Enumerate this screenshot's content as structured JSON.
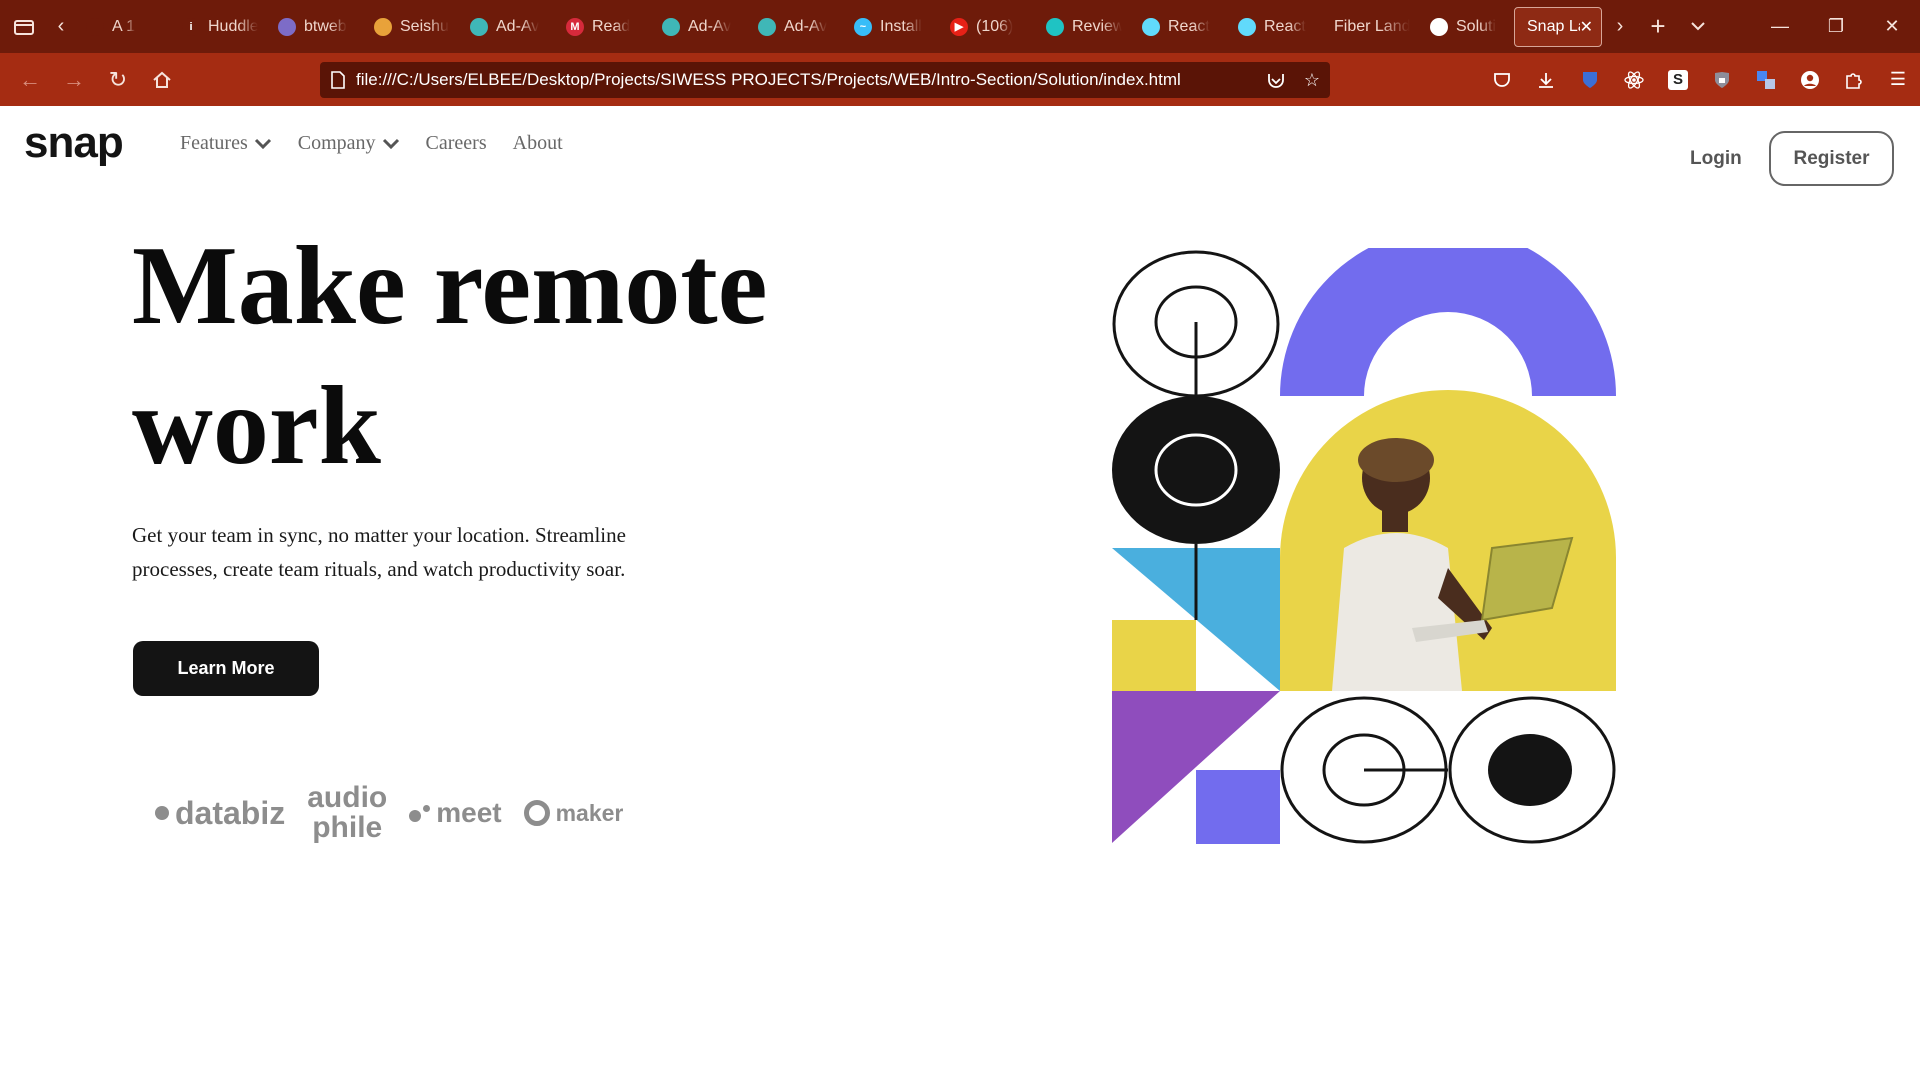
{
  "browser": {
    "tabs": [
      {
        "label": "A 1",
        "fav_color": "#6e1b0a",
        "fav_glyph": ""
      },
      {
        "label": "Huddle",
        "fav_color": "#6e1b0a",
        "fav_glyph": "i"
      },
      {
        "label": "btweb",
        "fav_color": "#7d6cc7",
        "fav_glyph": ""
      },
      {
        "label": "Seishu",
        "fav_color": "#e8a23a",
        "fav_glyph": ""
      },
      {
        "label": "Ad-Av",
        "fav_color": "#3fb7b7",
        "fav_glyph": ""
      },
      {
        "label": "Read",
        "fav_color": "#d62a3b",
        "fav_glyph": "M"
      },
      {
        "label": "Ad-Av",
        "fav_color": "#3fb7b7",
        "fav_glyph": ""
      },
      {
        "label": "Ad-Av",
        "fav_color": "#3fb7b7",
        "fav_glyph": ""
      },
      {
        "label": "Install",
        "fav_color": "#38bdf8",
        "fav_glyph": "~"
      },
      {
        "label": "(106)",
        "fav_color": "#e62117",
        "fav_glyph": "▶"
      },
      {
        "label": "Review",
        "fav_color": "#1fc3c3",
        "fav_glyph": ""
      },
      {
        "label": "React",
        "fav_color": "#61dafb",
        "fav_glyph": ""
      },
      {
        "label": "React",
        "fav_color": "#61dafb",
        "fav_glyph": ""
      },
      {
        "label": "Fiber Land",
        "fav_color": "",
        "fav_glyph": ""
      },
      {
        "label": "Soluti",
        "fav_color": "#ffffff",
        "fav_glyph": ""
      },
      {
        "label": "Snap La",
        "fav_color": "",
        "fav_glyph": ""
      }
    ],
    "url": "file:///C:/Users/ELBEE/Desktop/Projects/SIWESS PROJECTS/Projects/WEB/Intro-Section/Solution/index.html"
  },
  "site": {
    "logo": "snap",
    "nav": {
      "features": "Features",
      "company": "Company",
      "careers": "Careers",
      "about": "About"
    },
    "login": "Login",
    "register": "Register",
    "hero": {
      "title": "Make remote work",
      "text": "Get your team in sync, no matter your location. Streamline processes, create team rituals, and watch productivity soar.",
      "cta": "Learn More"
    },
    "clients": {
      "databiz": "databiz",
      "audiophile_top": "audio",
      "audiophile_bottom": "phile",
      "meet": "meet",
      "maker": "maker"
    },
    "colors": {
      "purple": "#726cee",
      "yellow": "#e9d448",
      "blue": "#4aafde",
      "violet": "#8f4dbd",
      "dark": "#141414"
    }
  }
}
